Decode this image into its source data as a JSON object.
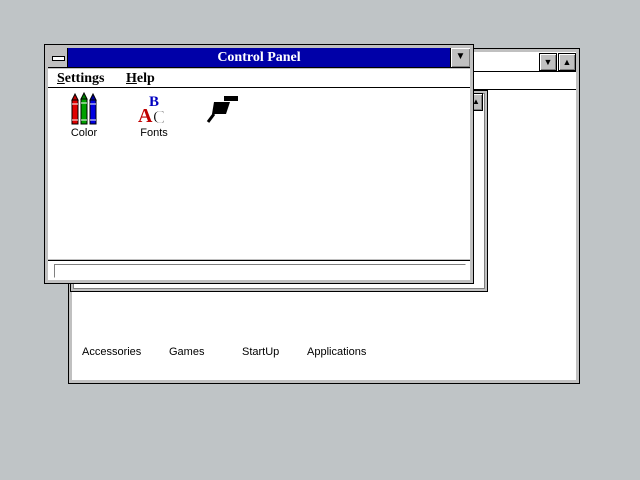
{
  "control_panel": {
    "title": "Control Panel",
    "menu": {
      "settings": {
        "hotkey": "S",
        "rest": "ettings"
      },
      "help": {
        "hotkey": "H",
        "rest": "elp"
      }
    },
    "icons": [
      {
        "label": "Color",
        "icon": "crayons-icon"
      },
      {
        "label": "Fonts",
        "icon": "fonts-icon"
      },
      {
        "label": "",
        "icon": "plug-icon"
      }
    ]
  },
  "program_manager": {
    "groups": [
      "Accessories",
      "Games",
      "StartUp",
      "Applications"
    ]
  }
}
